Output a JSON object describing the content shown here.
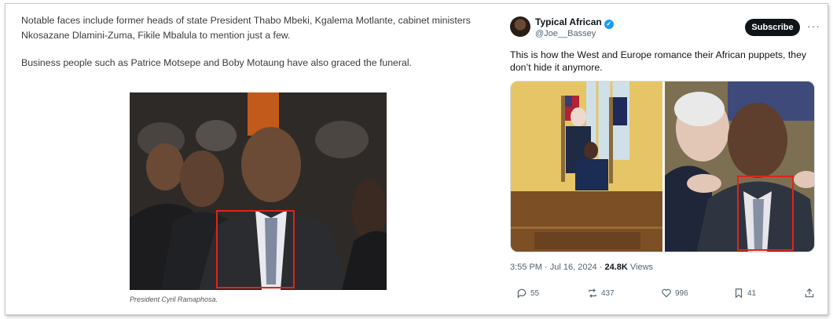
{
  "article": {
    "paragraph1": "Notable faces include former heads of state President Thabo Mbeki, Kgalema Motlante, cabinet ministers Nkosazane Dlamini-Zuma, Fikile Mbalula to mention just a few.",
    "paragraph2": "Business people such as Patrice Motsepe and Boby Motaung have also graced the funeral.",
    "caption": "President Cyril Ramaphosa."
  },
  "tweet": {
    "display_name": "Typical African",
    "handle": "@Joe__Bassey",
    "subscribe_label": "Subscribe",
    "more_label": "···",
    "text": "This is how the West and Europe romance their African puppets, they don’t hide it anymore.",
    "timestamp": "3:55 PM · Jul 16, 2024 · ",
    "views_count": "24.8K",
    "views_label": " Views",
    "replies": "55",
    "reposts": "437",
    "likes": "996",
    "bookmarks": "41"
  },
  "colors": {
    "highlight": "#e0241b",
    "verified": "#1d9bf0",
    "subscribe_bg": "#0f1419"
  }
}
